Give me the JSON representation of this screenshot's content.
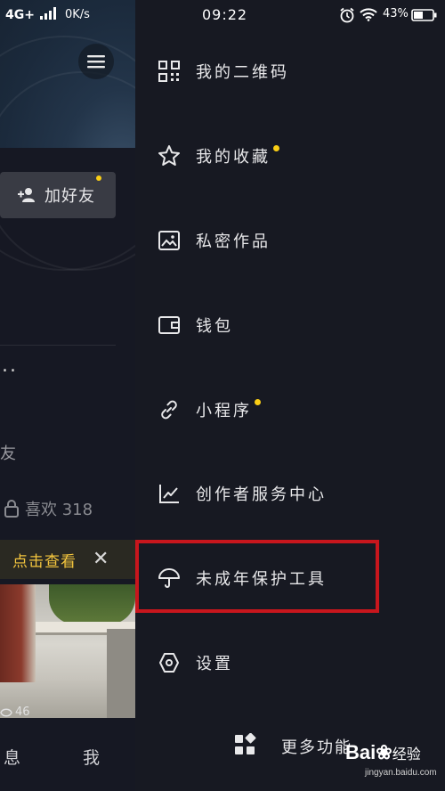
{
  "status_bar": {
    "network": "4G+",
    "speed": "0K/s",
    "time": "09:22",
    "battery": "43%"
  },
  "left": {
    "add_friend_label": "加好友",
    "ellipsis": "..",
    "fragment_text": "友",
    "likes_label": "喜欢 318",
    "banner_text": "点击查看",
    "banner_close": "✕",
    "views": "46",
    "tab_msg": "息",
    "tab_me": "我"
  },
  "drawer": {
    "items": [
      {
        "label": "我的二维码",
        "icon": "qr-code-icon",
        "dot": false
      },
      {
        "label": "我的收藏",
        "icon": "star-icon",
        "dot": true
      },
      {
        "label": "私密作品",
        "icon": "image-icon",
        "dot": false
      },
      {
        "label": "钱包",
        "icon": "wallet-icon",
        "dot": false
      },
      {
        "label": "小程序",
        "icon": "link-icon",
        "dot": true
      },
      {
        "label": "创作者服务中心",
        "icon": "chart-icon",
        "dot": false
      },
      {
        "label": "未成年保护工具",
        "icon": "umbrella-icon",
        "dot": false
      },
      {
        "label": "设置",
        "icon": "settings-icon",
        "dot": false
      }
    ],
    "more_label": "更多功能"
  },
  "watermark": {
    "brand": "Bai",
    "brand_suffix": "经验",
    "url": "jingyan.baidu.com"
  },
  "colors": {
    "background": "#161823",
    "accent_dot": "#face15",
    "highlight_border": "#c8161d",
    "banner_text": "#f3c53e"
  }
}
